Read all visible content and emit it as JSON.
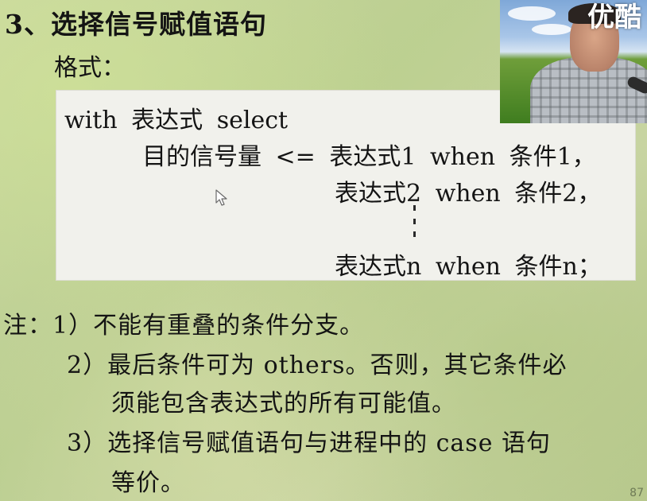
{
  "slide": {
    "title": "3、选择信号赋值语句",
    "format_label": "格式：",
    "syntax": {
      "line1": "with  表达式  select",
      "line2": "目的信号量 <= 表达式1  when  条件1，",
      "line3": "表达式2  when  条件2，",
      "line4": "表达式n  when  条件n；"
    },
    "notes": {
      "note1": "注：1）不能有重叠的条件分支。",
      "note2_a": "2）最后条件可为 others。否则，其它条件必",
      "note2_b": "须能包含表达式的所有可能值。",
      "note3_a": "3）选择信号赋值语句与进程中的 case 语句",
      "note3_b": "等价。"
    },
    "page_number": "87"
  },
  "video_overlay": {
    "watermark": "优酷"
  },
  "icons": {
    "cursor": "mouse-cursor-icon",
    "vertical_ellipsis": "vertical-ellipsis-icon"
  },
  "colors": {
    "background": "#c4d49a",
    "syntax_box": "#f1f1ec",
    "text": "#141414"
  }
}
